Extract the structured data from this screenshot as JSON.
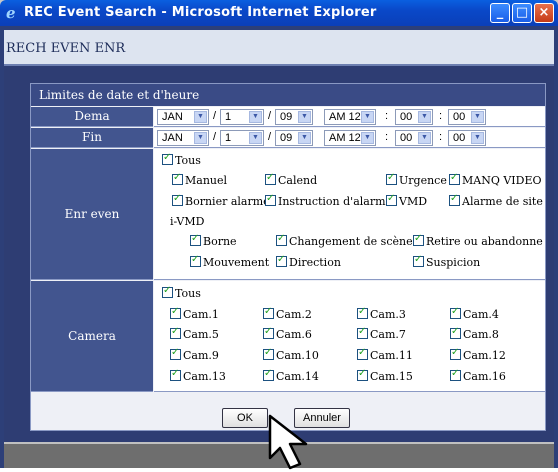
{
  "window": {
    "title": "REC Event Search - Microsoft Internet Explorer"
  },
  "header": {
    "title": "RECH EVEN ENR"
  },
  "panel": {
    "heading": "Limites de date et d'heure"
  },
  "start": {
    "label": "Dema",
    "month": "JAN",
    "day": "1",
    "year": "09",
    "ampm": "AM 12",
    "minute": "00",
    "second": "00",
    "sep1": "/",
    "sep2": "/",
    "sep3": ":",
    "sep4": ":"
  },
  "end": {
    "label": "Fin",
    "month": "JAN",
    "day": "1",
    "year": "09",
    "ampm": "AM 12",
    "minute": "00",
    "second": "00",
    "sep1": "/",
    "sep2": "/",
    "sep3": ":",
    "sep4": ":"
  },
  "events": {
    "label": "Enr even",
    "all": "Tous",
    "items": [
      "Manuel",
      "Calend",
      "Urgence",
      "MANQ VIDEO",
      "Bornier alarme",
      "Instruction d'alarme",
      "VMD",
      "Alarme de site"
    ],
    "ivmd_label": "i-VMD",
    "ivmd_items": [
      "Borne",
      "Changement de scène",
      "Retire ou abandonne",
      "Mouvement",
      "Direction",
      "Suspicion"
    ]
  },
  "camera": {
    "label": "Camera",
    "all": "Tous",
    "items": [
      "Cam.1",
      "Cam.2",
      "Cam.3",
      "Cam.4",
      "Cam.5",
      "Cam.6",
      "Cam.7",
      "Cam.8",
      "Cam.9",
      "Cam.10",
      "Cam.11",
      "Cam.12",
      "Cam.13",
      "Cam.14",
      "Cam.15",
      "Cam.16"
    ]
  },
  "buttons": {
    "ok": "OK",
    "cancel": "Annuler"
  },
  "colors": {
    "titlebar": "#0a48c8",
    "page_bg": "#2d3f78",
    "label_bg": "#42558f",
    "check": "#21a121"
  }
}
